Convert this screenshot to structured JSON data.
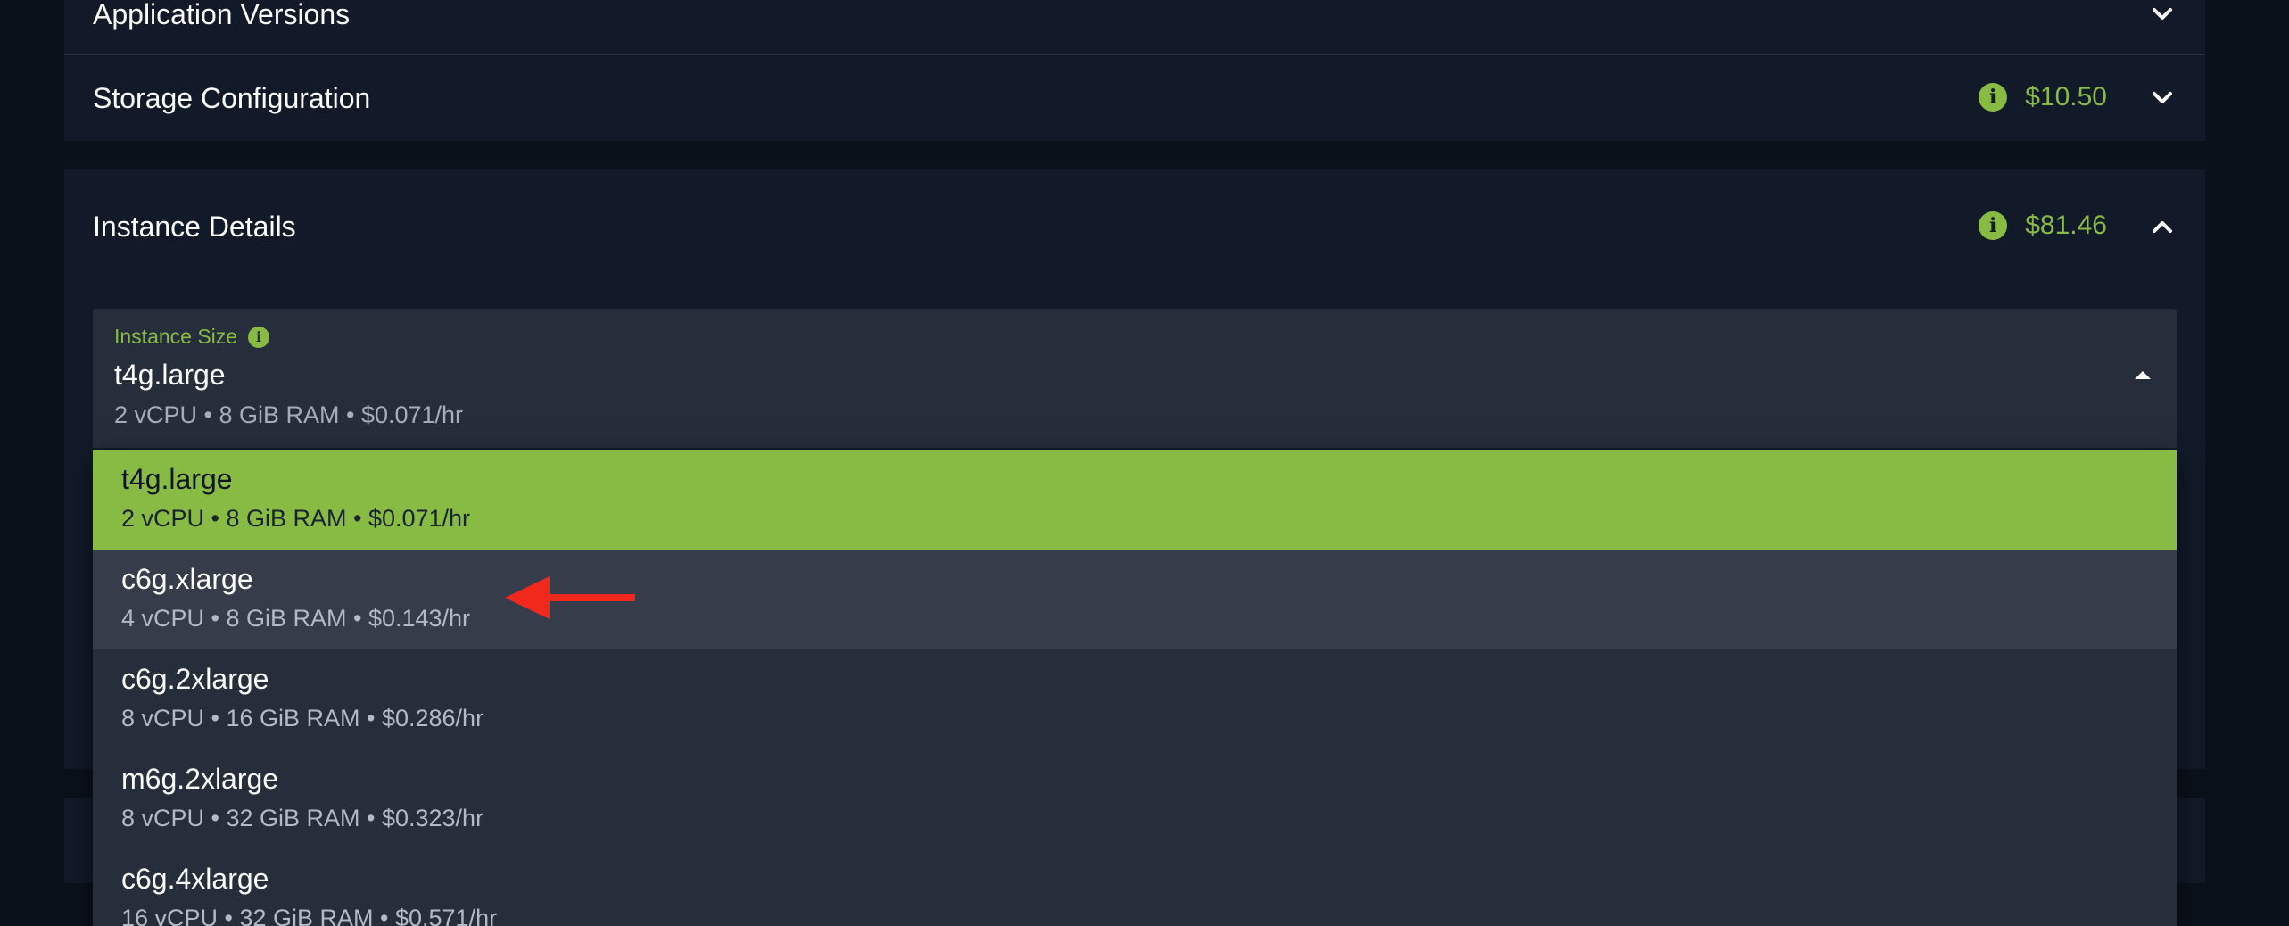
{
  "sections": {
    "application_versions": {
      "title": "Application Versions"
    },
    "storage_configuration": {
      "title": "Storage Configuration",
      "price": "$10.50"
    },
    "instance_details": {
      "title": "Instance Details",
      "price": "$81.46"
    }
  },
  "instance_size": {
    "label": "Instance Size",
    "selected_value": "t4g.large",
    "selected_description": "2 vCPU • 8 GiB RAM • $0.071/hr"
  },
  "dropdown_options": [
    {
      "name": "t4g.large",
      "description": "2 vCPU • 8 GiB RAM • $0.071/hr",
      "state": "selected"
    },
    {
      "name": "c6g.xlarge",
      "description": "4 vCPU • 8 GiB RAM • $0.143/hr",
      "state": "hover"
    },
    {
      "name": "c6g.2xlarge",
      "description": "8 vCPU • 16 GiB RAM • $0.286/hr",
      "state": "normal"
    },
    {
      "name": "m6g.2xlarge",
      "description": "8 vCPU • 32 GiB RAM • $0.323/hr",
      "state": "normal"
    },
    {
      "name": "c6g.4xlarge",
      "description": "16 vCPU • 32 GiB RAM • $0.571/hr",
      "state": "normal"
    }
  ],
  "icons": {
    "info": "info-icon",
    "expand": "chevron-down-icon",
    "collapse": "chevron-up-icon",
    "dropdown_caret": "caret-up-icon",
    "annotation": "red-arrow-icon"
  },
  "colors": {
    "background": "#0b111b",
    "panel": "#121a29",
    "field": "#262d3b",
    "accent_green": "#88bb44",
    "hover": "#363c4a",
    "annotation_red": "#f0291c"
  }
}
